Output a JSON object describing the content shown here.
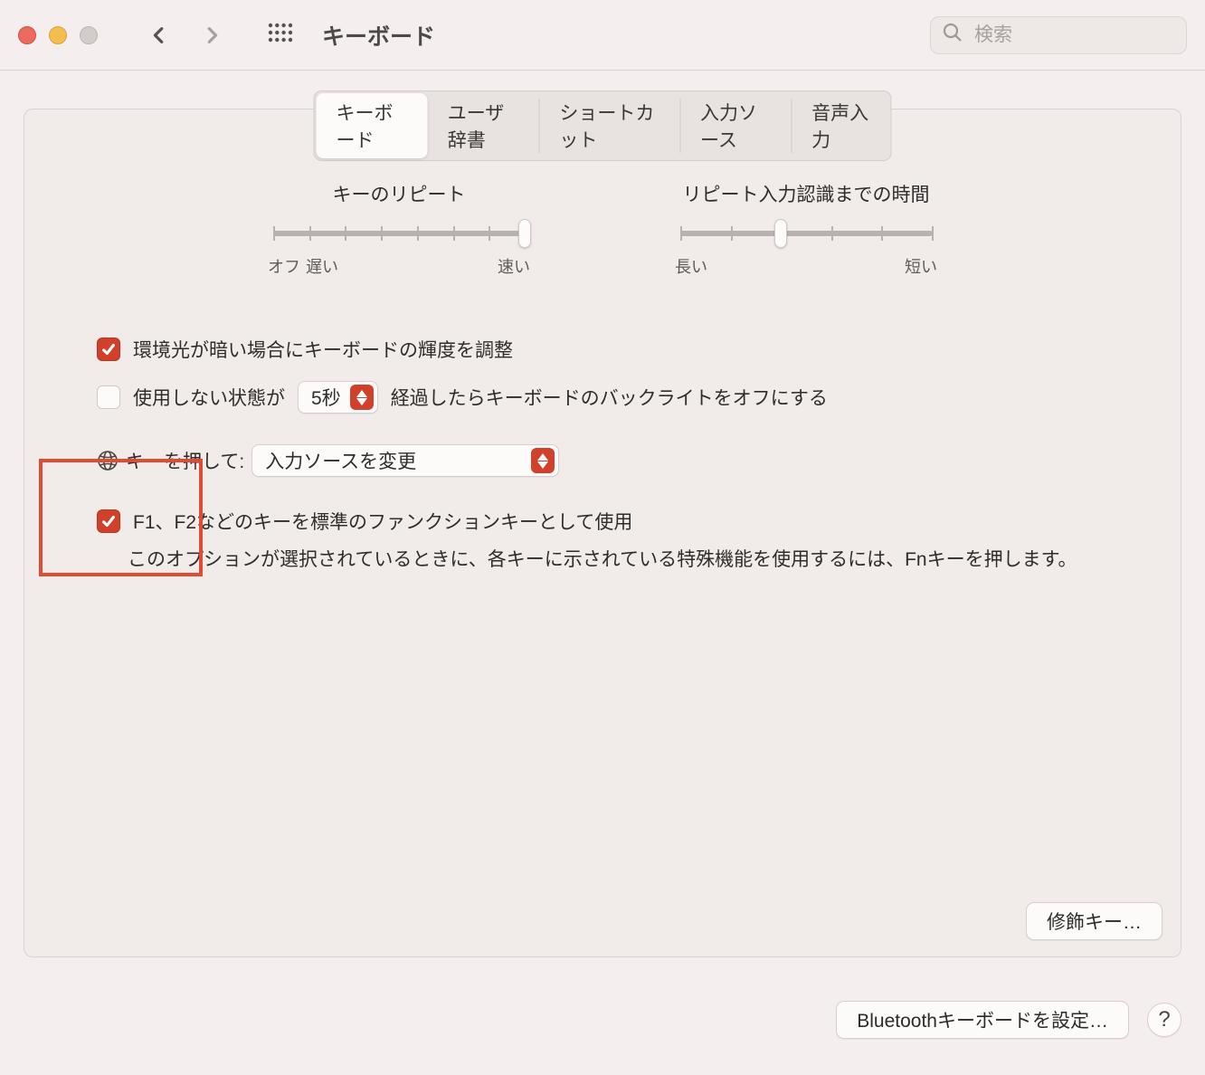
{
  "window": {
    "title": "キーボード"
  },
  "search": {
    "placeholder": "検索"
  },
  "tabs": [
    {
      "label": "キーボード",
      "selected": true
    },
    {
      "label": "ユーザ辞書",
      "selected": false
    },
    {
      "label": "ショートカット",
      "selected": false
    },
    {
      "label": "入力ソース",
      "selected": false
    },
    {
      "label": "音声入力",
      "selected": false
    }
  ],
  "sliders": {
    "repeat": {
      "title": "キーのリピート",
      "min_label": "オフ",
      "near_min_label": "遅い",
      "max_label": "速い",
      "ticks": 8,
      "value_index": 7
    },
    "delay": {
      "title": "リピート入力認識までの時間",
      "min_label": "長い",
      "max_label": "短い",
      "ticks": 6,
      "value_index": 2
    }
  },
  "options": {
    "ambient": {
      "checked": true,
      "label": "環境光が暗い場合にキーボードの輝度を調整"
    },
    "backlight_off": {
      "checked": false,
      "prefix": "使用しない状態が",
      "select_value": "5秒",
      "suffix": "経過したらキーボードのバックライトをオフにする"
    },
    "globe": {
      "label_prefix": "キーを押して:",
      "select_value": "入力ソースを変更"
    },
    "fn_keys": {
      "checked": true,
      "label": "F1、F2などのキーを標準のファンクションキーとして使用",
      "description": "このオプションが選択されているときに、各キーに示されている特殊機能を使用するには、Fnキーを押します。"
    }
  },
  "buttons": {
    "modifier_keys": "修飾キー…",
    "bluetooth": "Bluetoothキーボードを設定…",
    "help": "?"
  }
}
